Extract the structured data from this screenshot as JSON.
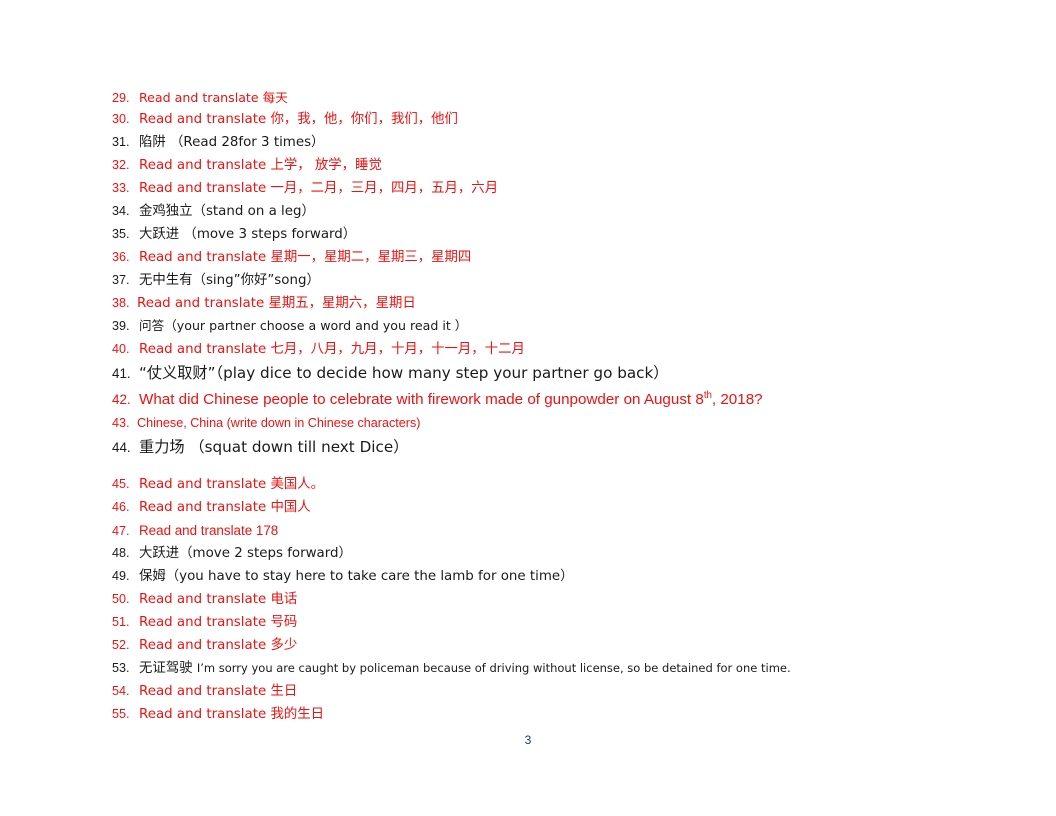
{
  "document": {
    "page_number": "3",
    "colors": {
      "red": "#ee1111",
      "dark": "#1a1a1a",
      "page_number": "#17365d",
      "background": "#ffffff"
    }
  },
  "items": [
    {
      "number": "29.",
      "text": "Read and translate 每天"
    },
    {
      "number": "30.",
      "text": " Read and translate 你，我，他，你们，我们，他们"
    },
    {
      "number": "31.",
      "text": "陷阱 （Read 28for 3 times）"
    },
    {
      "number": "32.",
      "text": "Read and translate 上学， 放学，睡觉"
    },
    {
      "number": "33.",
      "text": "Read and translate 一月，二月，三月，四月，五月，六月"
    },
    {
      "number": "34.",
      "text": " 金鸡独立（stand on a leg）"
    },
    {
      "number": "35.",
      "text": "大跃进 （move 3 steps forward）"
    },
    {
      "number": "36.",
      "text": "Read and translate 星期一，星期二，星期三，星期四"
    },
    {
      "number": "37.",
      "text": "无中生有（sing”你好”song）"
    },
    {
      "number": "38.",
      "text": "Read and translate 星期五，星期六，星期日"
    },
    {
      "number": "39.",
      "text": "问答（your partner choose a word and you read it ）"
    },
    {
      "number": "40.",
      "text": "Read and translate 七月，八月，九月，十月，十一月，十二月"
    },
    {
      "number": "41.",
      "text": "“仗义取财”（play dice to decide how many step your partner go back）"
    },
    {
      "number": "42.",
      "text_before_sup": "What did Chinese people to celebrate with firework made of gunpowder on August 8",
      "sup": "th",
      "text_after_sup": ", 2018?"
    },
    {
      "number": "43.",
      "text": "Chinese, China (write down in Chinese characters)"
    },
    {
      "number": "44.",
      "text_main": "重力场 （squat down till next ",
      "text_emph": "Dice",
      "text_tail": "）"
    },
    {
      "number": "45.",
      "text": "Read and translate 美国人。"
    },
    {
      "number": "46.",
      "text": "Read and translate 中国人"
    },
    {
      "number": "47.",
      "text": "Read and translate 178"
    },
    {
      "number": "48.",
      "text": "大跃进（move 2 steps forward）"
    },
    {
      "number": "49.",
      "text": "保姆（you have to stay here to take care the lamb for one time）"
    },
    {
      "number": "50.",
      "text": "Read and translate 电话"
    },
    {
      "number": "51.",
      "text": "Read and translate 号码"
    },
    {
      "number": "52.",
      "text": "Read and translate 多少"
    },
    {
      "number": "53.",
      "text_cjk": "无证驾驶 ",
      "text_en": "I’m sorry you are caught by policeman because of driving without license, so be detained for one time."
    },
    {
      "number": "54.",
      "text": "Read and translate 生日"
    },
    {
      "number": "55.",
      "text": "Read and translate 我的生日"
    }
  ]
}
